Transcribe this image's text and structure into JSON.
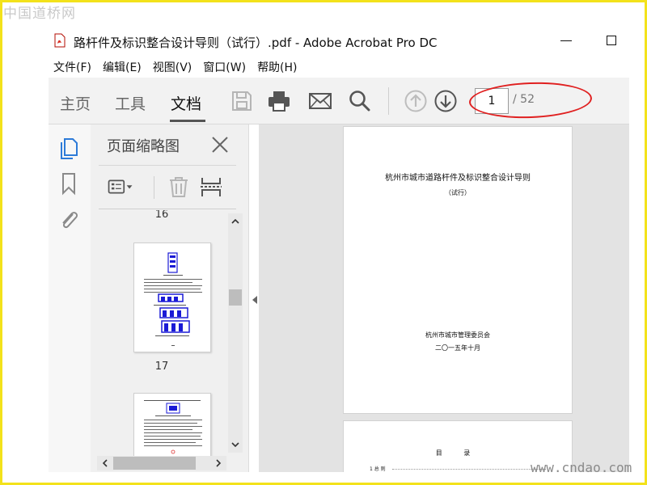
{
  "watermarks": {
    "top": "中国道桥网",
    "bottom": "www.cndao.com"
  },
  "window": {
    "title": "路杆件及标识整合设计导则（试行）.pdf - Adobe Acrobat Pro DC"
  },
  "menu": [
    "文件(F)",
    "编辑(E)",
    "视图(V)",
    "窗口(W)",
    "帮助(H)"
  ],
  "toolbar": {
    "tabs": [
      "主页",
      "工具",
      "文档"
    ],
    "active_tab": "文档",
    "icons": [
      "save-icon",
      "print-icon",
      "email-icon",
      "search-icon",
      "previous-page-icon",
      "next-page-icon"
    ],
    "page_current": "1",
    "page_total": "/ 52",
    "highlight_color": "#e02020"
  },
  "left_rail": {
    "icons": [
      "page-thumbnails-icon",
      "bookmark-icon",
      "attachment-icon"
    ]
  },
  "thumbnails_panel": {
    "title": "页面缩略图",
    "tool_icons": [
      "options-icon",
      "delete-icon",
      "insert-page-icon"
    ],
    "pages": [
      {
        "label": "16"
      },
      {
        "label": "17"
      }
    ]
  },
  "document": {
    "page1": {
      "title": "杭州市城市道路杆件及标识整合设计导则",
      "subtitle": "（试行）",
      "organization": "杭州市城市管理委员会",
      "date": "二〇一五年十月"
    },
    "page2": {
      "toc_title": "目 录",
      "toc_first_entry": "1 总 则"
    }
  },
  "colors": {
    "frame": "#f3e21b",
    "toolbar_bg": "#f2f2f2",
    "doc_bg": "#e3e3e3",
    "thumb_ink": "#1a1ad6"
  }
}
